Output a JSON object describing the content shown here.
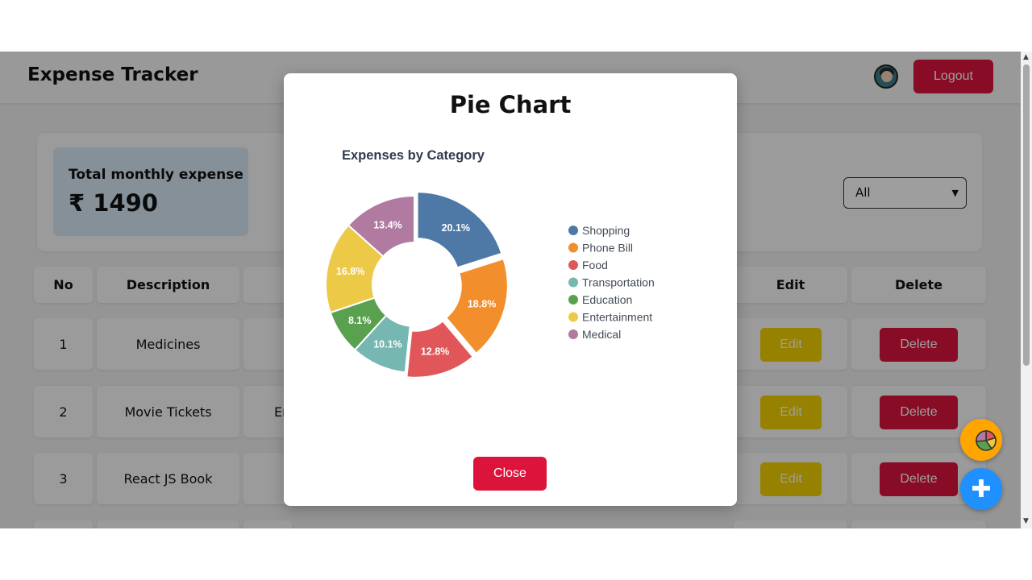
{
  "app": {
    "title": "Expense Tracker",
    "logout_label": "Logout"
  },
  "summary": {
    "label": "Total monthly expense",
    "value": "₹ 1490",
    "filter_selected": "All"
  },
  "table": {
    "headers": {
      "no": "No",
      "description": "Description",
      "edit": "Edit",
      "delete": "Delete"
    },
    "rows": [
      {
        "no": "1",
        "description": "Medicines",
        "category_partial": "",
        "edit": "Edit",
        "delete": "Delete"
      },
      {
        "no": "2",
        "description": "Movie Tickets",
        "category_partial": "Er",
        "edit": "Edit",
        "delete": "Delete"
      },
      {
        "no": "3",
        "description": "React JS Book",
        "category_partial": "",
        "edit": "Edit",
        "delete": "Delete"
      }
    ]
  },
  "fab": {
    "add_symbol": "✚",
    "chart_icon": "pie-chart-icon"
  },
  "modal": {
    "title": "Pie Chart",
    "close_label": "Close"
  },
  "chart_data": {
    "type": "pie",
    "title": "Expenses by Category",
    "donut": true,
    "legend_position": "right",
    "categories": [
      "Shopping",
      "Phone Bill",
      "Food",
      "Transportation",
      "Education",
      "Entertainment",
      "Medical"
    ],
    "values": [
      20.1,
      18.8,
      12.8,
      10.1,
      8.1,
      16.8,
      13.4
    ],
    "labels": [
      "20.1%",
      "18.8%",
      "12.8%",
      "10.1%",
      "8.1%",
      "16.8%",
      "13.4%"
    ],
    "colors": [
      "#4e79a7",
      "#f28e2b",
      "#e15759",
      "#76b7b2",
      "#59a14f",
      "#edc948",
      "#b07aa1"
    ],
    "exploded": [
      "Shopping",
      "Phone Bill",
      "Food"
    ]
  }
}
